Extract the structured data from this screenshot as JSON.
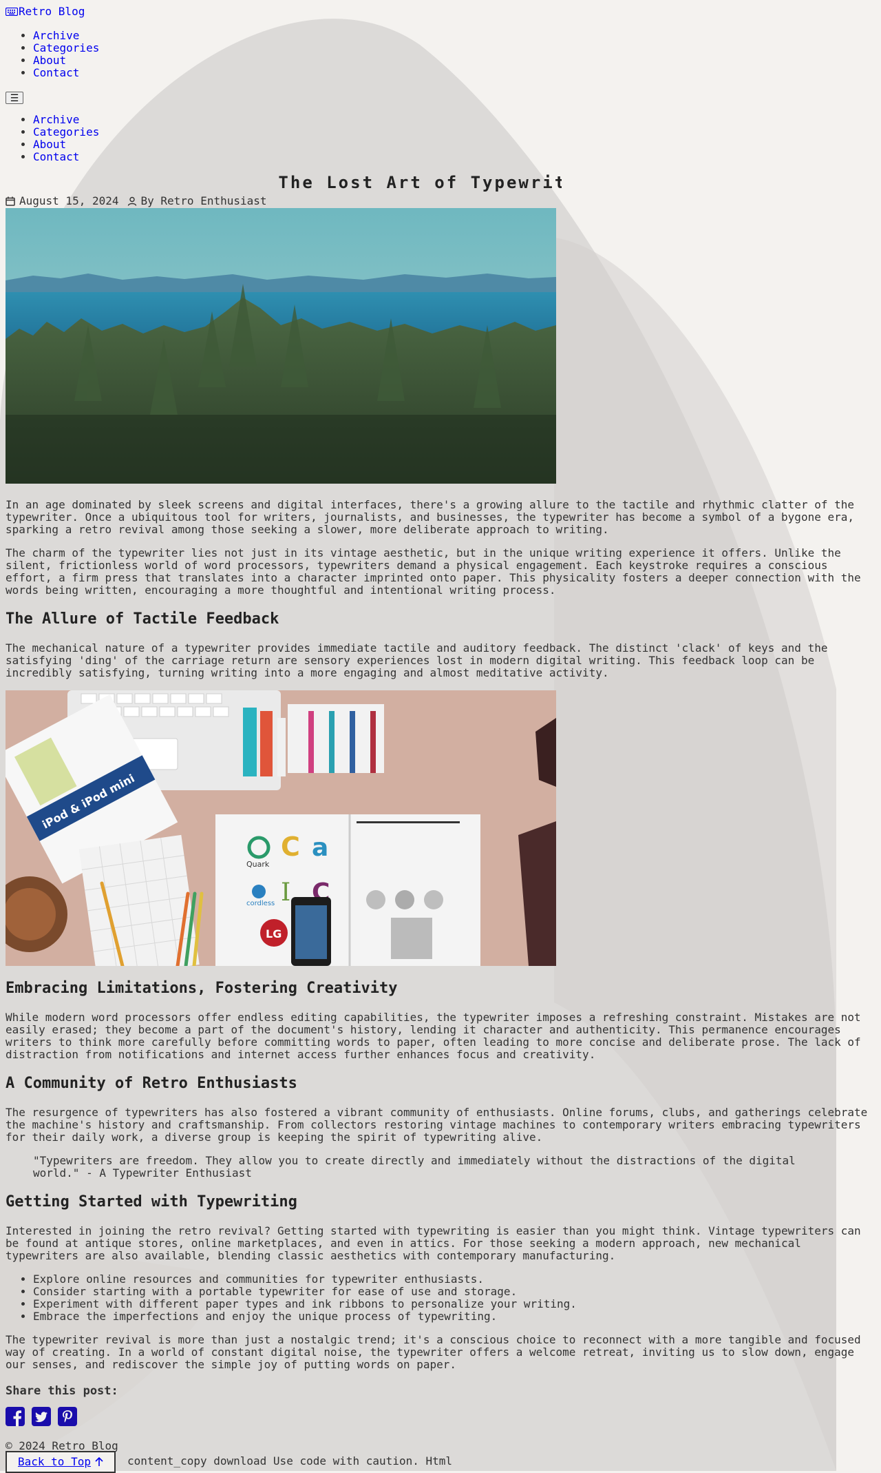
{
  "site": {
    "title": "Retro Blog",
    "logo_icon": "typewriter-keyboard-icon"
  },
  "nav": {
    "items": [
      {
        "label": "Archive"
      },
      {
        "label": "Categories"
      },
      {
        "label": "About"
      },
      {
        "label": "Contact"
      }
    ]
  },
  "mobile_menu": {
    "button_label": "☰",
    "items": [
      {
        "label": "Archive"
      },
      {
        "label": "Categories"
      },
      {
        "label": "About"
      },
      {
        "label": "Contact"
      }
    ]
  },
  "post": {
    "title": "The Lost Art of Typewriting",
    "date": "August 15, 2024",
    "author": "By Retro Enthusiast",
    "intro": [
      "In an age dominated by sleek screens and digital interfaces, there's a growing allure to the tactile and rhythmic clatter of the typewriter. Once a ubiquitous tool for writers, journalists, and businesses, the typewriter has become a symbol of a bygone era, sparking a retro revival among those seeking a slower, more deliberate approach to writing.",
      "The charm of the typewriter lies not just in its vintage aesthetic, but in the unique writing experience it offers. Unlike the silent, frictionless world of word processors, typewriters demand a physical engagement. Each keystroke requires a conscious effort, a firm press that translates into a character imprinted onto paper. This physicality fosters a deeper connection with the words being written, encouraging a more thoughtful and intentional writing process."
    ],
    "section1": {
      "heading": "The Allure of Tactile Feedback",
      "text": "The mechanical nature of a typewriter provides immediate tactile and auditory feedback. The distinct 'clack' of keys and the satisfying 'ding' of the carriage return are sensory experiences lost in modern digital writing. This feedback loop can be incredibly satisfying, turning writing into a more engaging and almost meditative activity."
    },
    "desk_image": {
      "ipod_label": "iPod & iPod mini",
      "logo_quark": "Quark",
      "logo_cordless": "cordless"
    },
    "section2": {
      "heading": "Embracing Limitations, Fostering Creativity",
      "text": "While modern word processors offer endless editing capabilities, the typewriter imposes a refreshing constraint. Mistakes are not easily erased; they become a part of the document's history, lending it character and authenticity. This permanence encourages writers to think more carefully before committing words to paper, often leading to more concise and deliberate prose. The lack of distraction from notifications and internet access further enhances focus and creativity."
    },
    "section3": {
      "heading": "A Community of Retro Enthusiasts",
      "text": "The resurgence of typewriters has also fostered a vibrant community of enthusiasts. Online forums, clubs, and gatherings celebrate the machine's history and craftsmanship. From collectors restoring vintage machines to contemporary writers embracing typewriters for their daily work, a diverse group is keeping the spirit of typewriting alive.",
      "quote": "\"Typewriters are freedom. They allow you to create directly and immediately without the distractions of the digital world.\" - A Typewriter Enthusiast"
    },
    "section4": {
      "heading": "Getting Started with Typewriting",
      "text": "Interested in joining the retro revival? Getting started with typewriting is easier than you might think. Vintage typewriters can be found at antique stores, online marketplaces, and even in attics. For those seeking a modern approach, new mechanical typewriters are also available, blending classic aesthetics with contemporary manufacturing.",
      "tips": [
        "Explore online resources and communities for typewriter enthusiasts.",
        "Consider starting with a portable typewriter for ease of use and storage.",
        "Experiment with different paper types and ink ribbons to personalize your writing.",
        "Embrace the imperfections and enjoy the unique process of typewriting."
      ]
    },
    "conclusion": "The typewriter revival is more than just a nostalgic trend; it's a conscious choice to reconnect with a more tangible and focused way of creating. In a world of constant digital noise, the typewriter offers a welcome retreat, inviting us to slow down, engage our senses, and rediscover the simple joy of putting words on paper.",
    "share": {
      "title": "Share this post:",
      "icons": [
        "facebook-icon",
        "twitter-icon",
        "pinterest-icon"
      ],
      "color": "#1a0dab"
    }
  },
  "footer": {
    "copyright": "© 2024 Retro Blog",
    "back_to_top": "Back to Top",
    "trailing_text": "content_copy download Use code with caution. Html"
  }
}
